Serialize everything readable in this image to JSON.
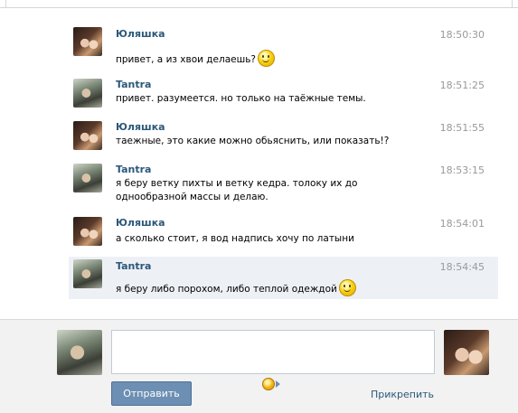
{
  "messages": [
    {
      "sender": "Юляшка",
      "time": "18:50:30",
      "text": "привет, а из хвои делаешь?",
      "emoji": "smiley-icon"
    },
    {
      "sender": "Tantra",
      "time": "18:51:25",
      "text": "привет. разумеется. но только на таёжные темы."
    },
    {
      "sender": "Юляшка",
      "time": "18:51:55",
      "text": "таежные, это какие можно обьяснить, или показать!?"
    },
    {
      "sender": "Tantra",
      "time": "18:53:15",
      "text": "я беру ветку пихты и ветку кедра. толоку их до однообразной массы и делаю."
    },
    {
      "sender": "Юляшка",
      "time": "18:54:01",
      "text": "а сколько стоит, я вод надпись хочу по латыни"
    },
    {
      "sender": "Tantra",
      "time": "18:54:45",
      "text": "я беру либо порохом, либо теплой одеждой",
      "emoji": "smiley-icon"
    }
  ],
  "composer": {
    "message_value": "",
    "send_label": "Отправить",
    "attach_label": "Прикрепить"
  },
  "colors": {
    "name_link": "#2b587a",
    "highlight_bg": "#edf1f5",
    "send_button": "#6d8fb3",
    "composer_bg": "#f2f2f2"
  }
}
